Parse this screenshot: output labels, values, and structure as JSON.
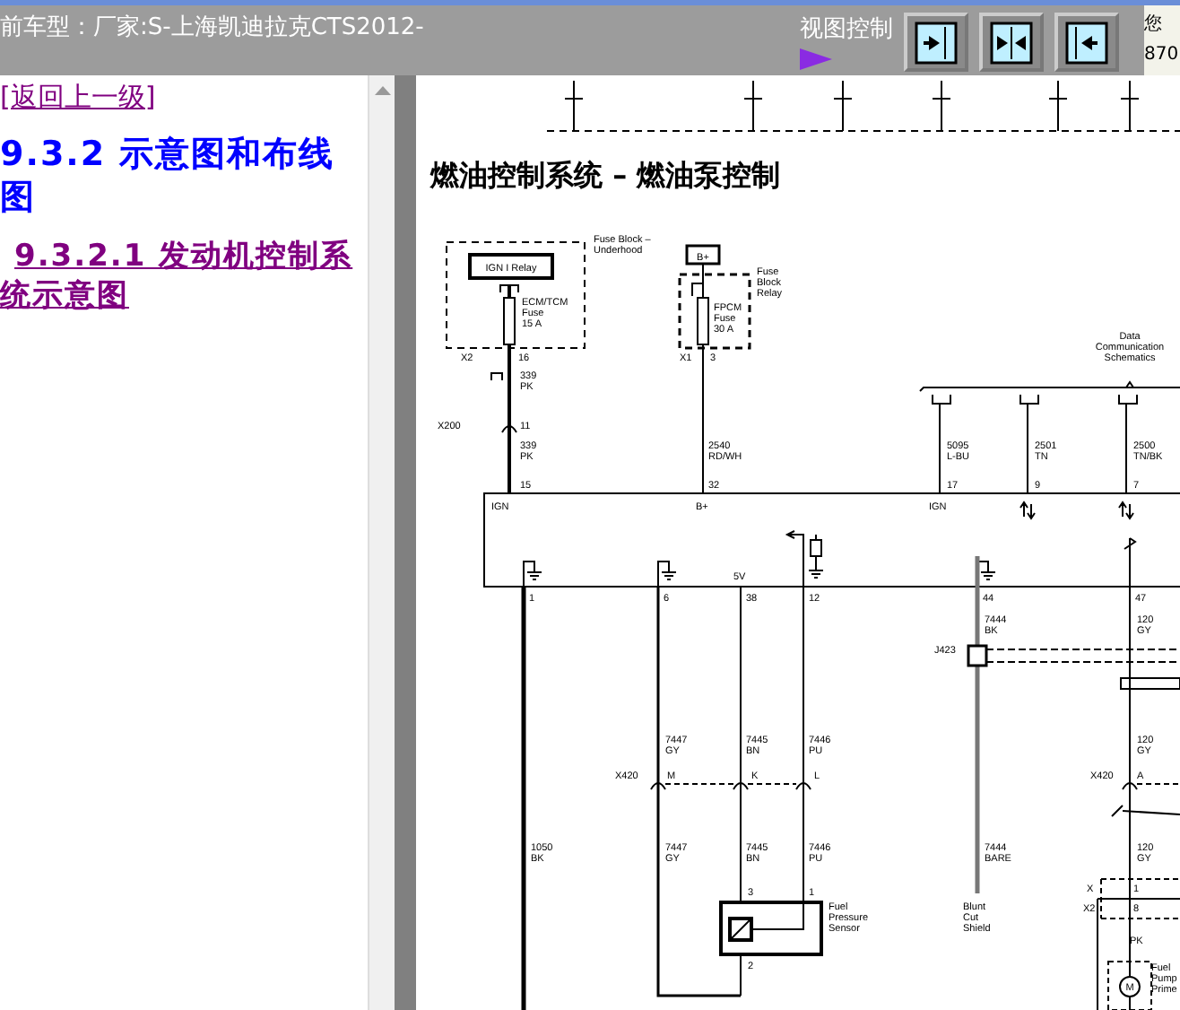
{
  "header": {
    "model_text": "前车型：厂家:S-上海凯迪拉克CTS2012-",
    "view_control_label": "视图控制",
    "user_info": [
      "您",
      "870"
    ]
  },
  "nav": {
    "back_link": "[返回上一级]",
    "section_heading": "9.3.2 示意图和布线图",
    "subsection_link": "9.3.2.1 发动机控制系统示意图"
  },
  "diagram": {
    "title": "燃油控制系统 – 燃油泵控制",
    "labels": [
      "Fuse Block –",
      "Underhood",
      "IGN I Relay",
      "ECM/TCM",
      "Fuse",
      "15 A",
      "B+",
      "Fuse",
      "Block",
      "Relay",
      "FPCM",
      "Fuse",
      "30 A",
      "X2",
      "16",
      "X1",
      "3",
      "339",
      "PK",
      "X200",
      "11",
      "339",
      "PK",
      "2540",
      "RD/WH",
      "Data",
      "Communication",
      "Schematics",
      "5095",
      "L-BU",
      "2501",
      "TN",
      "2500",
      "TN/BK",
      "15",
      "32",
      "17",
      "9",
      "7",
      "IGN",
      "B+",
      "IGN",
      "5V",
      "1",
      "6",
      "38",
      "12",
      "44",
      "47",
      "7444",
      "BK",
      "120",
      "GY",
      "J423",
      "7447",
      "GY",
      "7445",
      "BN",
      "7446",
      "PU",
      "120",
      "GY",
      "X420",
      "M",
      "K",
      "L",
      "X420",
      "A",
      "1050",
      "BK",
      "7447",
      "GY",
      "7445",
      "BN",
      "7446",
      "PU",
      "7444",
      "BARE",
      "120",
      "GY",
      "X",
      "1",
      "X2",
      "8",
      "3",
      "1",
      "Fuel",
      "Pressure",
      "Sensor",
      "2",
      "Blunt",
      "Cut",
      "Shield",
      "PK",
      "Fuel",
      "Pump",
      "Prime",
      "M"
    ]
  }
}
